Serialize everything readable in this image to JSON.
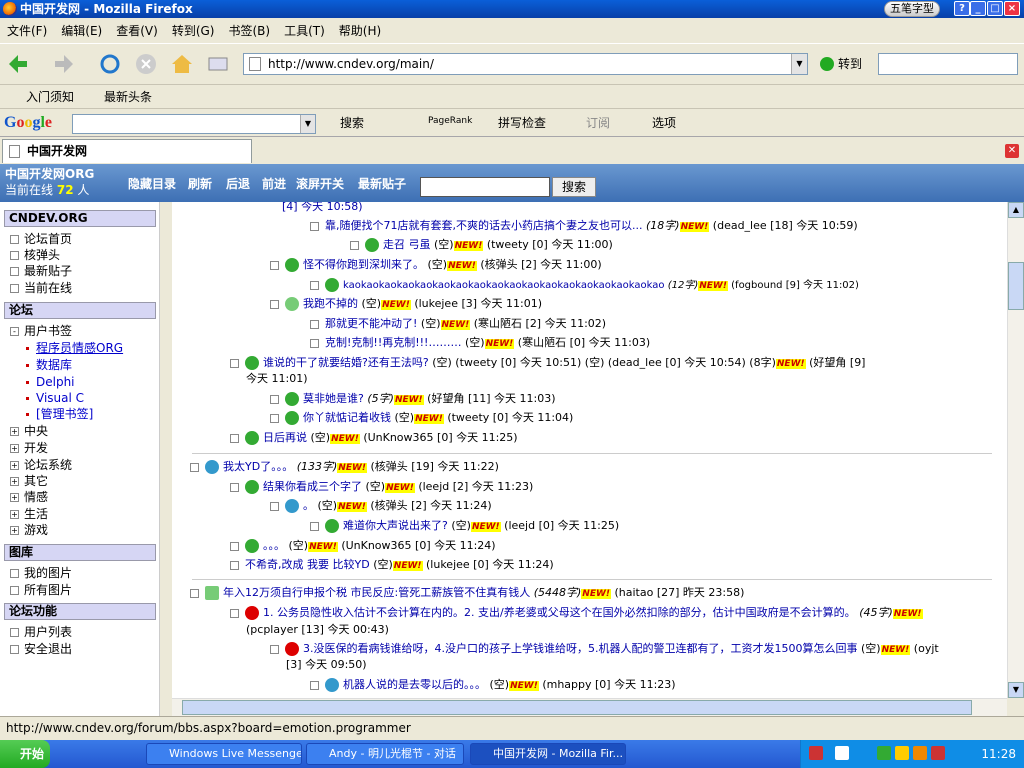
{
  "window": {
    "title": "中国开发网 - Mozilla Firefox",
    "ime": "五笔字型"
  },
  "menu": [
    "文件(F)",
    "编辑(E)",
    "查看(V)",
    "转到(G)",
    "书签(B)",
    "工具(T)",
    "帮助(H)"
  ],
  "nav": {
    "url": "http://www.cndev.org/main/",
    "go_label": "转到"
  },
  "bookmarks": [
    "入门须知",
    "最新头条"
  ],
  "google": {
    "logo": "Google",
    "search": "搜索",
    "pagerank": "PageRank",
    "spell": "拼写检查",
    "subscribe": "订阅",
    "options": "选项"
  },
  "tab": {
    "title": "中国开发网"
  },
  "site": {
    "name": "中国开发网ORG",
    "online_label": "当前在线",
    "online_count": "72",
    "online_unit": "人",
    "links": [
      "隐藏目录",
      "刷新",
      "后退",
      "前进",
      "滚屏开关",
      "最新贴子"
    ],
    "search_btn": "搜索"
  },
  "sidebar": {
    "h1": "CNDEV.ORG",
    "top": [
      "论坛首页",
      "核弹头",
      "最新贴子",
      "当前在线"
    ],
    "h2": "论坛",
    "user_bm": "用户书签",
    "subs": [
      "程序员情感ORG",
      "数据库",
      "Delphi",
      "Visual C",
      "[管理书签]"
    ],
    "cats": [
      "中央",
      "开发",
      "论坛系统",
      "其它",
      "情感",
      "生活",
      "游戏"
    ],
    "h3": "图库",
    "gal": [
      "我的图片",
      "所有图片"
    ],
    "h4": "论坛功能",
    "funcs": [
      "用户列表",
      "安全退出"
    ]
  },
  "posts": [
    {
      "t": "[4] 今天 10:58)",
      "m": ""
    },
    {
      "t": "靠,随便找个71店就有套套,不爽的话去小药店搞个妻之友也可以...",
      "m": "(18字)",
      "n": "NEW!",
      "a": "(dead_lee [18] 今天 10:59)"
    },
    {
      "t": "走召 弓虽",
      "m": "(空)",
      "n": "NEW!",
      "a": "(tweety [0] 今天 11:00)"
    },
    {
      "t": "怪不得你跑到深圳来了。",
      "m": "(空)",
      "n": "NEW!",
      "a": "(核弹头 [2] 今天 11:00)"
    },
    {
      "t": "kaokaokaokaokaokaokaokaokaokaokaokaokaokaokaokaokaokao",
      "m": "(12字)",
      "n": "NEW!",
      "a": "(fogbound [9] 今天 11:02)"
    },
    {
      "t": "我跑不掉的",
      "m": "(空)",
      "n": "NEW!",
      "a": "(lukejee [3] 今天 11:01)"
    },
    {
      "t": "那就更不能冲动了!",
      "m": "(空)",
      "n": "NEW!",
      "a": "(寒山陋石 [2] 今天 11:02)"
    },
    {
      "t": "克制!克制!!再克制!!!………",
      "m": "(空)",
      "n": "NEW!",
      "a": "(寒山陋石 [0] 今天 11:03)"
    },
    {
      "t": "谁说的干了就要结婚?还有王法吗?",
      "m": "(空)",
      "a": "(tweety [0] 今天 10:51) (空) (dead_lee [0] 今天 10:54) (8字)",
      "n": "NEW!",
      "a2": "(好望角 [9]",
      "a3": "今天 11:01)"
    },
    {
      "t": "莫非她是谁?",
      "m": "(5字)",
      "n": "NEW!",
      "a": "(好望角 [11] 今天 11:03)"
    },
    {
      "t": "你丫就惦记着收钱",
      "m": "(空)",
      "n": "NEW!",
      "a": "(tweety [0] 今天 11:04)"
    },
    {
      "t": "日后再说",
      "m": "(空)",
      "n": "NEW!",
      "a": "(UnKnow365 [0] 今天 11:25)"
    },
    {
      "t": "我太YD了。。。",
      "m": "(133字)",
      "n": "NEW!",
      "a": "(核弹头 [19] 今天 11:22)"
    },
    {
      "t": "结果你看成三个字了",
      "m": "(空)",
      "n": "NEW!",
      "a": "(leejd [2] 今天 11:23)"
    },
    {
      "t": "。",
      "m": "(空)",
      "n": "NEW!",
      "a": "(核弹头 [2] 今天 11:24)"
    },
    {
      "t": "难道你大声说出来了?",
      "m": "(空)",
      "n": "NEW!",
      "a": "(leejd [0] 今天 11:25)"
    },
    {
      "t": "。。。",
      "m": "(空)",
      "n": "NEW!",
      "a": "(UnKnow365 [0] 今天 11:24)"
    },
    {
      "t": "不希奇,改成 我要 比较YD",
      "m": "(空)",
      "n": "NEW!",
      "a": "(lukejee [0] 今天 11:24)"
    },
    {
      "t": "年入12万须自行申报个税 市民反应:管死工薪族管不住真有钱人",
      "m": "(5448字)",
      "n": "NEW!",
      "a": "(haitao [27] 昨天 23:58)"
    },
    {
      "t": "1. 公务员隐性收入估计不会计算在内的。2. 支出/养老婆或父母这个在国外必然扣除的部分，估计中国政府是不会计算的。",
      "m": "(45字)",
      "n": "NEW!",
      "a": "(pcplayer [13] 今天 00:43)"
    },
    {
      "t": "3.没医保的看病钱谁给呀，4.没户口的孩子上学钱谁给呀，5.机器人配的警卫连都有了，工资才发1500算怎么回事",
      "m": "(空)",
      "n": "NEW!",
      "a": "(oyjt",
      "a2": "[3] 今天 09:50)"
    },
    {
      "t": "机器人说的是去零以后的。。。",
      "m": "(空)",
      "n": "NEW!",
      "a": "(mhappy [0] 今天 11:23)"
    }
  ],
  "status": "http://www.cndev.org/forum/bbs.aspx?board=emotion.programmer",
  "taskbar": {
    "start": "开始",
    "items": [
      "Windows Live Messenger",
      "Andy - 明儿光棍节 - 对话",
      "中国开发网 - Mozilla Fir..."
    ],
    "clock": "11:28"
  }
}
